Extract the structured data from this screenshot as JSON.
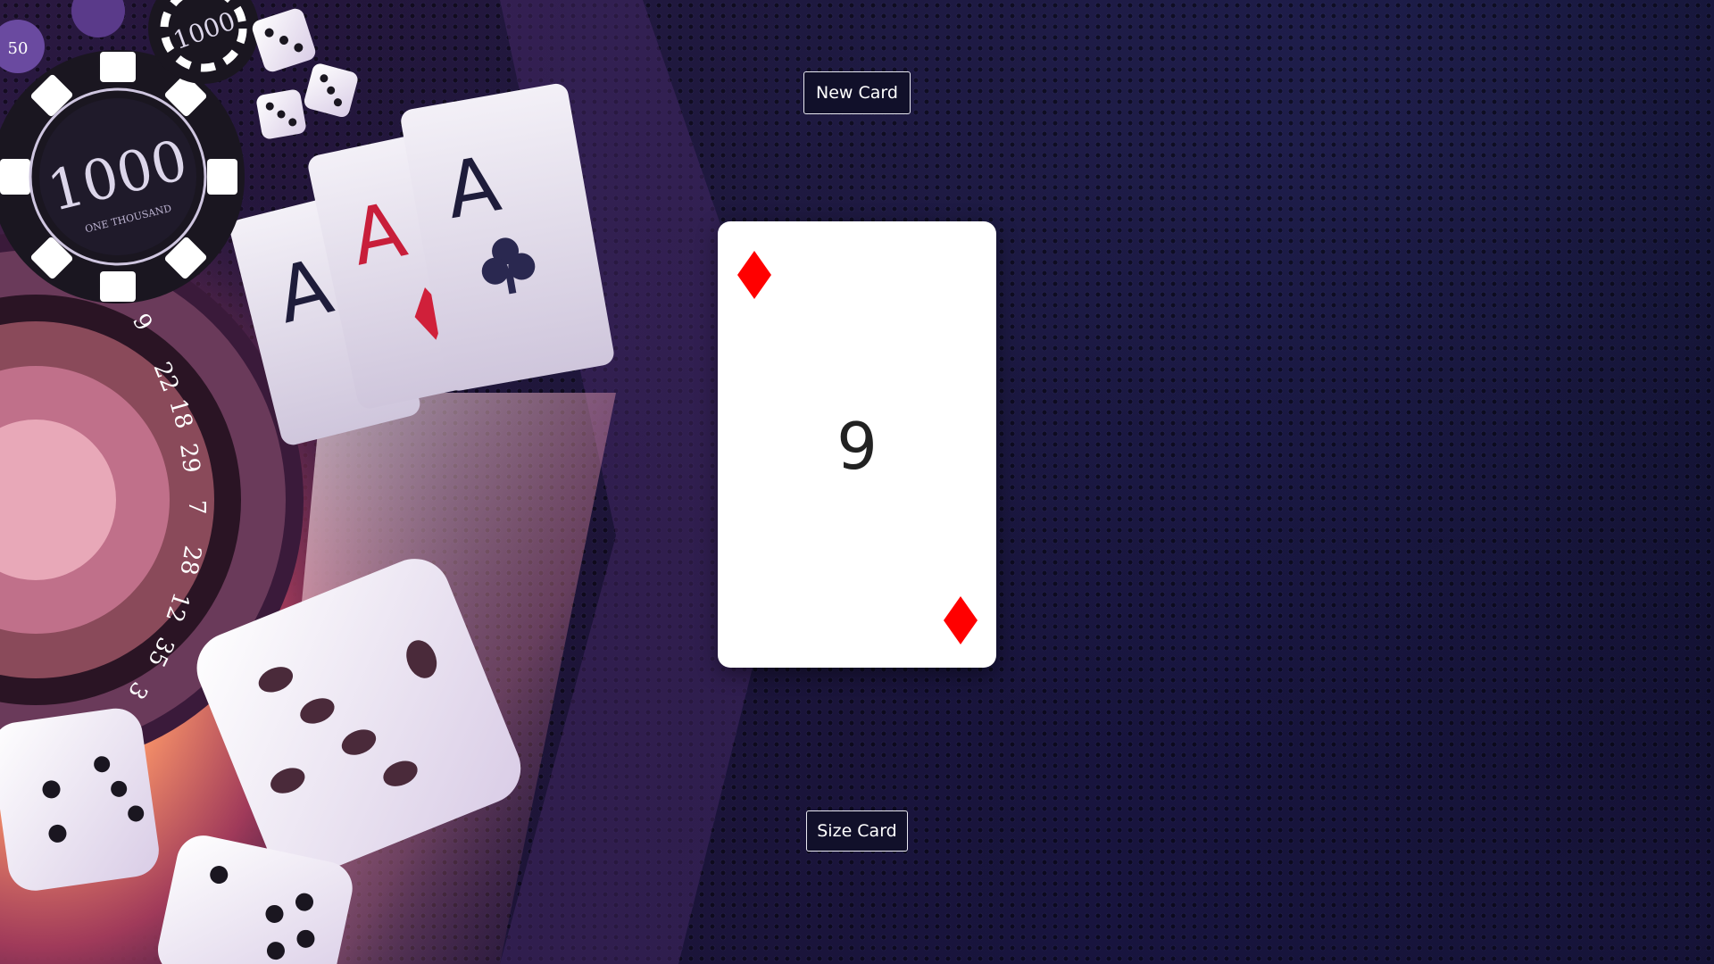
{
  "controls": {
    "new_card_label": "New Card",
    "size_card_label": "Size Card"
  },
  "card": {
    "rank": "9",
    "suit": "diamonds",
    "suit_icon": "diamond-icon",
    "suit_color": "#ff0000"
  },
  "background": {
    "theme": "casino",
    "chip_text": "1000",
    "chip_subtext": "ONE THOUSAND",
    "small_chip_text": "1000",
    "corner_chip_text": "50",
    "playing_card_ranks": [
      "A",
      "A",
      "A"
    ],
    "roulette_numbers": [
      "9",
      "22",
      "18",
      "29",
      "7",
      "28",
      "12",
      "35",
      "3"
    ]
  }
}
